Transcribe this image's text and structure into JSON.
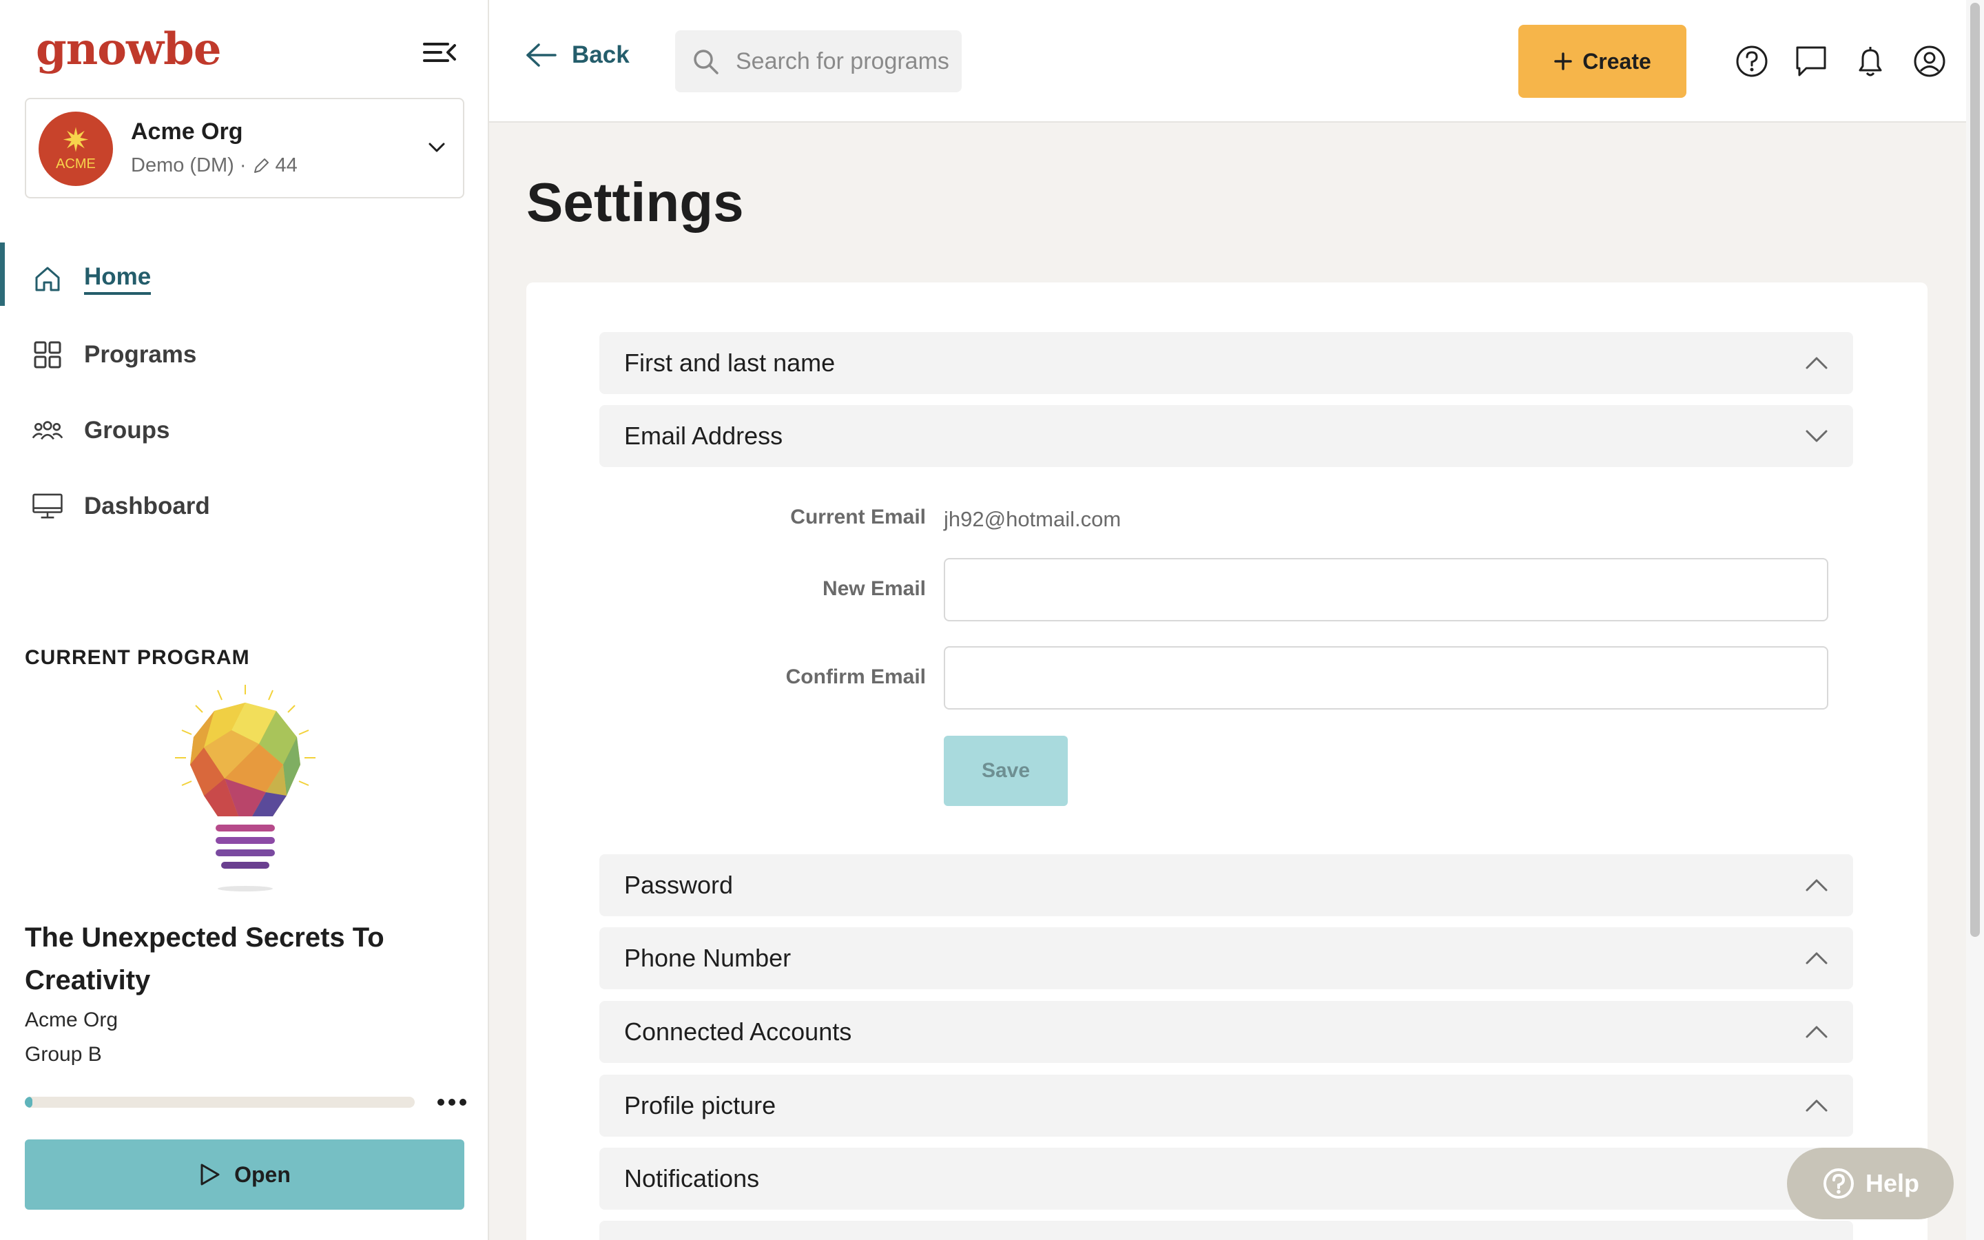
{
  "brand": {
    "logo_text": "gnowbe",
    "logo_color": "#c0392b",
    "accent": "#245d6b"
  },
  "org": {
    "name": "Acme Org",
    "avatar_text": "ACME",
    "subtitle": "Demo (DM) ·",
    "edit_count": "44"
  },
  "nav": [
    {
      "label": "Home",
      "icon": "home-icon",
      "active": true
    },
    {
      "label": "Programs",
      "icon": "grid-icon",
      "active": false
    },
    {
      "label": "Groups",
      "icon": "group-icon",
      "active": false
    },
    {
      "label": "Dashboard",
      "icon": "monitor-icon",
      "active": false
    }
  ],
  "current_program": {
    "heading": "CURRENT PROGRAM",
    "title": "The Unexpected Secrets To Creativity",
    "org": "Acme Org",
    "group": "Group B",
    "progress": 0.02,
    "open_label": "Open"
  },
  "topbar": {
    "back_label": "Back",
    "search_placeholder": "Search for programs",
    "create_label": "Create",
    "icons": [
      "help-circle-icon",
      "chat-icon",
      "bell-icon",
      "user-icon"
    ]
  },
  "page": {
    "title": "Settings"
  },
  "sections": {
    "name": "First and last name",
    "email": "Email Address",
    "password": "Password",
    "phone": "Phone Number",
    "connected": "Connected Accounts",
    "picture": "Profile picture",
    "notifications": "Notifications"
  },
  "email_form": {
    "current_label": "Current Email",
    "current_value": "jh92@hotmail.com",
    "new_label": "New Email",
    "new_value": "",
    "confirm_label": "Confirm Email",
    "confirm_value": "",
    "save_label": "Save"
  },
  "help": {
    "label": "Help"
  }
}
